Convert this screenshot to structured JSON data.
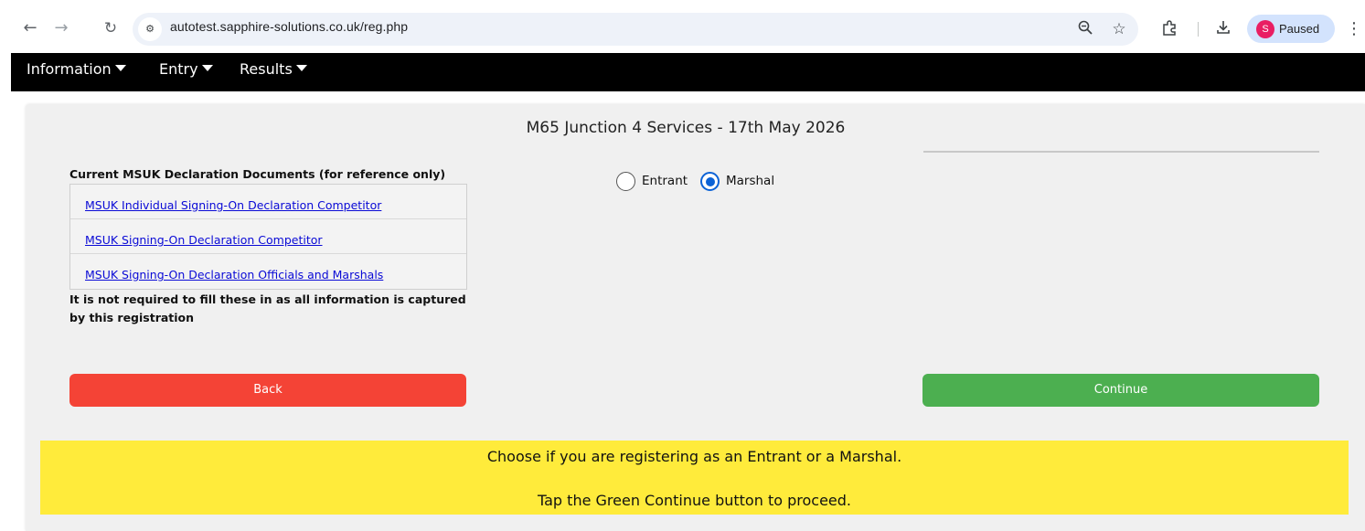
{
  "browser": {
    "url": "autotest.sapphire-solutions.co.uk/reg.php",
    "profile_initial": "S",
    "profile_status": "Paused"
  },
  "nav": {
    "items": [
      {
        "label": "Information"
      },
      {
        "label": "Entry"
      },
      {
        "label": "Results"
      }
    ]
  },
  "event": {
    "title": "M65 Junction 4 Services - 17th May 2026"
  },
  "documents": {
    "heading": "Current MSUK Declaration Documents (for reference only)",
    "links": [
      "MSUK Individual Signing-On Declaration Competitor",
      "MSUK Signing-On Declaration Competitor",
      "MSUK Signing-On Declaration Officials and Marshals"
    ],
    "note": "It is not required to fill these in as all information is captured by this registration"
  },
  "role": {
    "options": [
      "Entrant",
      "Marshal"
    ],
    "selected": "Marshal"
  },
  "buttons": {
    "back": "Back",
    "continue": "Continue"
  },
  "notice": {
    "line1": "Choose if you are registering as an Entrant or a Marshal.",
    "line2": "Tap the Green Continue button to proceed."
  },
  "colors": {
    "back_button": "#f44336",
    "continue_button": "#4caf50",
    "notice_background": "#ffeb3b",
    "nav_background": "#000000",
    "radio_selected": "#0b62d6"
  }
}
